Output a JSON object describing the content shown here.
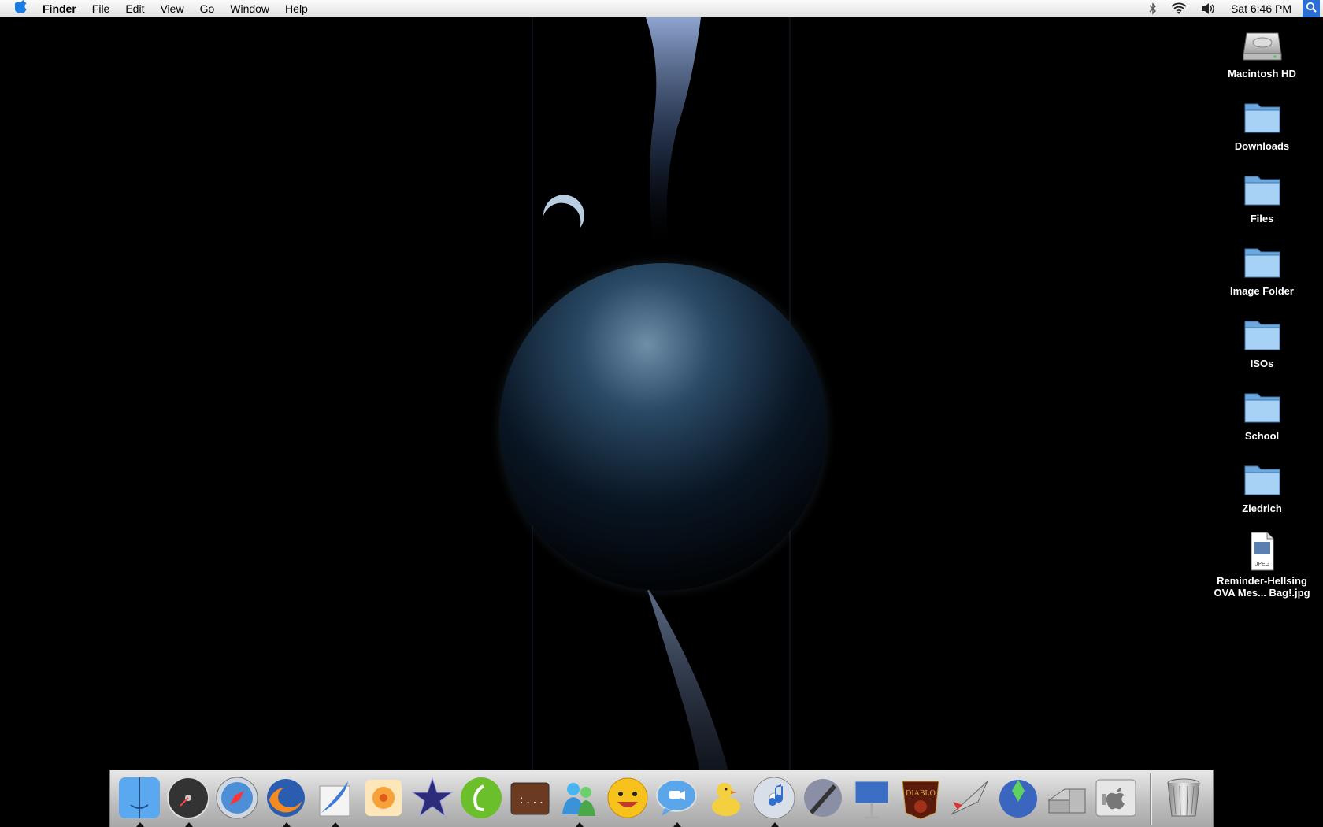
{
  "menubar": {
    "app_name": "Finder",
    "menus": [
      "File",
      "Edit",
      "View",
      "Go",
      "Window",
      "Help"
    ],
    "clock": "Sat 6:46 PM",
    "status_icons": [
      "bluetooth-icon",
      "wifi-icon",
      "volume-icon"
    ],
    "spotlight_icon": "spotlight-icon"
  },
  "desktop": {
    "icons": [
      {
        "label": "Macintosh HD",
        "type": "hard-drive"
      },
      {
        "label": "Downloads",
        "type": "folder"
      },
      {
        "label": "Files",
        "type": "folder"
      },
      {
        "label": "Image Folder",
        "type": "folder"
      },
      {
        "label": "ISOs",
        "type": "folder"
      },
      {
        "label": "School",
        "type": "folder"
      },
      {
        "label": "Ziedrich",
        "type": "folder"
      },
      {
        "label": "Reminder-Hellsing OVA Mes... Bag!.jpg",
        "type": "jpeg-file",
        "badge": "JPEG"
      }
    ]
  },
  "dock": {
    "apps": [
      {
        "name": "finder-dock-icon",
        "running": true
      },
      {
        "name": "dashboard-dock-icon",
        "running": true
      },
      {
        "name": "safari-dock-icon",
        "running": false
      },
      {
        "name": "firefox-dock-icon",
        "running": true
      },
      {
        "name": "feather-app-dock-icon",
        "running": true
      },
      {
        "name": "flower-app-dock-icon",
        "running": false
      },
      {
        "name": "star-app-dock-icon",
        "running": false
      },
      {
        "name": "dreamweaver-dock-icon",
        "running": false
      },
      {
        "name": "terminal-dock-icon",
        "running": false
      },
      {
        "name": "messenger-dock-icon",
        "running": true
      },
      {
        "name": "yahoo-messenger-dock-icon",
        "running": false
      },
      {
        "name": "ichat-dock-icon",
        "running": true
      },
      {
        "name": "adium-dock-icon",
        "running": false
      },
      {
        "name": "itunes-dock-icon",
        "running": true
      },
      {
        "name": "script-editor-dock-icon",
        "running": false
      },
      {
        "name": "keynote-dock-icon",
        "running": false
      },
      {
        "name": "diablo-dock-icon",
        "running": false
      },
      {
        "name": "jet-game-dock-icon",
        "running": false
      },
      {
        "name": "sims-dock-icon",
        "running": false
      },
      {
        "name": "scanner-dock-icon",
        "running": false
      },
      {
        "name": "system-preferences-dock-icon",
        "running": false
      }
    ],
    "trash_icon": "trash-icon"
  },
  "colors": {
    "folder": "#8fc4f2",
    "menubar": "#ececec",
    "spotlight": "#2a6fd6"
  }
}
